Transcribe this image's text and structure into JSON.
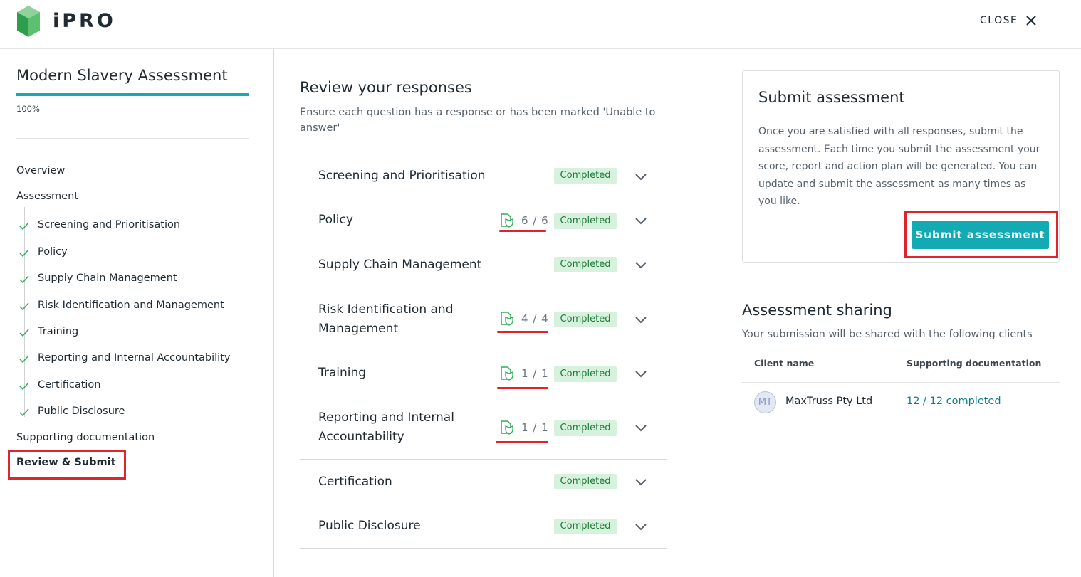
{
  "header": {
    "brand": "iPRO",
    "close_label": "CLOSE"
  },
  "sidebar": {
    "title": "Modern Slavery Assessment",
    "progress_percent": 100,
    "progress_text": "100%",
    "nav": {
      "overview": "Overview",
      "assessment": "Assessment",
      "sub_items": [
        "Screening and Prioritisation",
        "Policy",
        "Supply Chain Management",
        "Risk Identification and Management",
        "Training",
        "Reporting and Internal Accountability",
        "Certification",
        "Public Disclosure"
      ],
      "supporting_documentation": "Supporting documentation",
      "review_submit": "Review & Submit"
    }
  },
  "main": {
    "title": "Review your responses",
    "subtitle": "Ensure each question has a response or has been marked 'Unable to answer'",
    "sections": [
      {
        "title": "Screening and Prioritisation",
        "title_line2": "",
        "docs": "",
        "status": "Completed"
      },
      {
        "title": "Policy",
        "title_line2": "",
        "docs": "6 / 6",
        "status": "Completed"
      },
      {
        "title": "Supply Chain Management",
        "title_line2": "",
        "docs": "",
        "status": "Completed"
      },
      {
        "title": "Risk Identification and",
        "title_line2": "Management",
        "docs": "4 / 4",
        "status": "Completed"
      },
      {
        "title": "Training",
        "title_line2": "",
        "docs": "1 / 1",
        "status": "Completed"
      },
      {
        "title": "Reporting and Internal",
        "title_line2": "Accountability",
        "docs": "1 / 1",
        "status": "Completed"
      },
      {
        "title": "Certification",
        "title_line2": "",
        "docs": "",
        "status": "Completed"
      },
      {
        "title": "Public Disclosure",
        "title_line2": "",
        "docs": "",
        "status": "Completed"
      }
    ]
  },
  "submit_card": {
    "title": "Submit assessment",
    "text": "Once you are satisfied with all responses, submit the assessment. Each time you submit the assessment your score, report and action plan will be generated. You can update and submit the assessment as many times as you like.",
    "button_label": "Submit assessment"
  },
  "sharing": {
    "title": "Assessment sharing",
    "subtitle": "Your submission will be shared with the following clients",
    "col_client": "Client name",
    "col_docs": "Supporting documentation",
    "rows": [
      {
        "initials": "MT",
        "client": "MaxTruss Pty Ltd",
        "docs": "12 / 12 completed"
      }
    ]
  },
  "colors": {
    "accent": "#13aab4",
    "badge_bg": "#d6f2dc",
    "badge_text": "#1f7a3a",
    "highlight": "#e0242b"
  }
}
